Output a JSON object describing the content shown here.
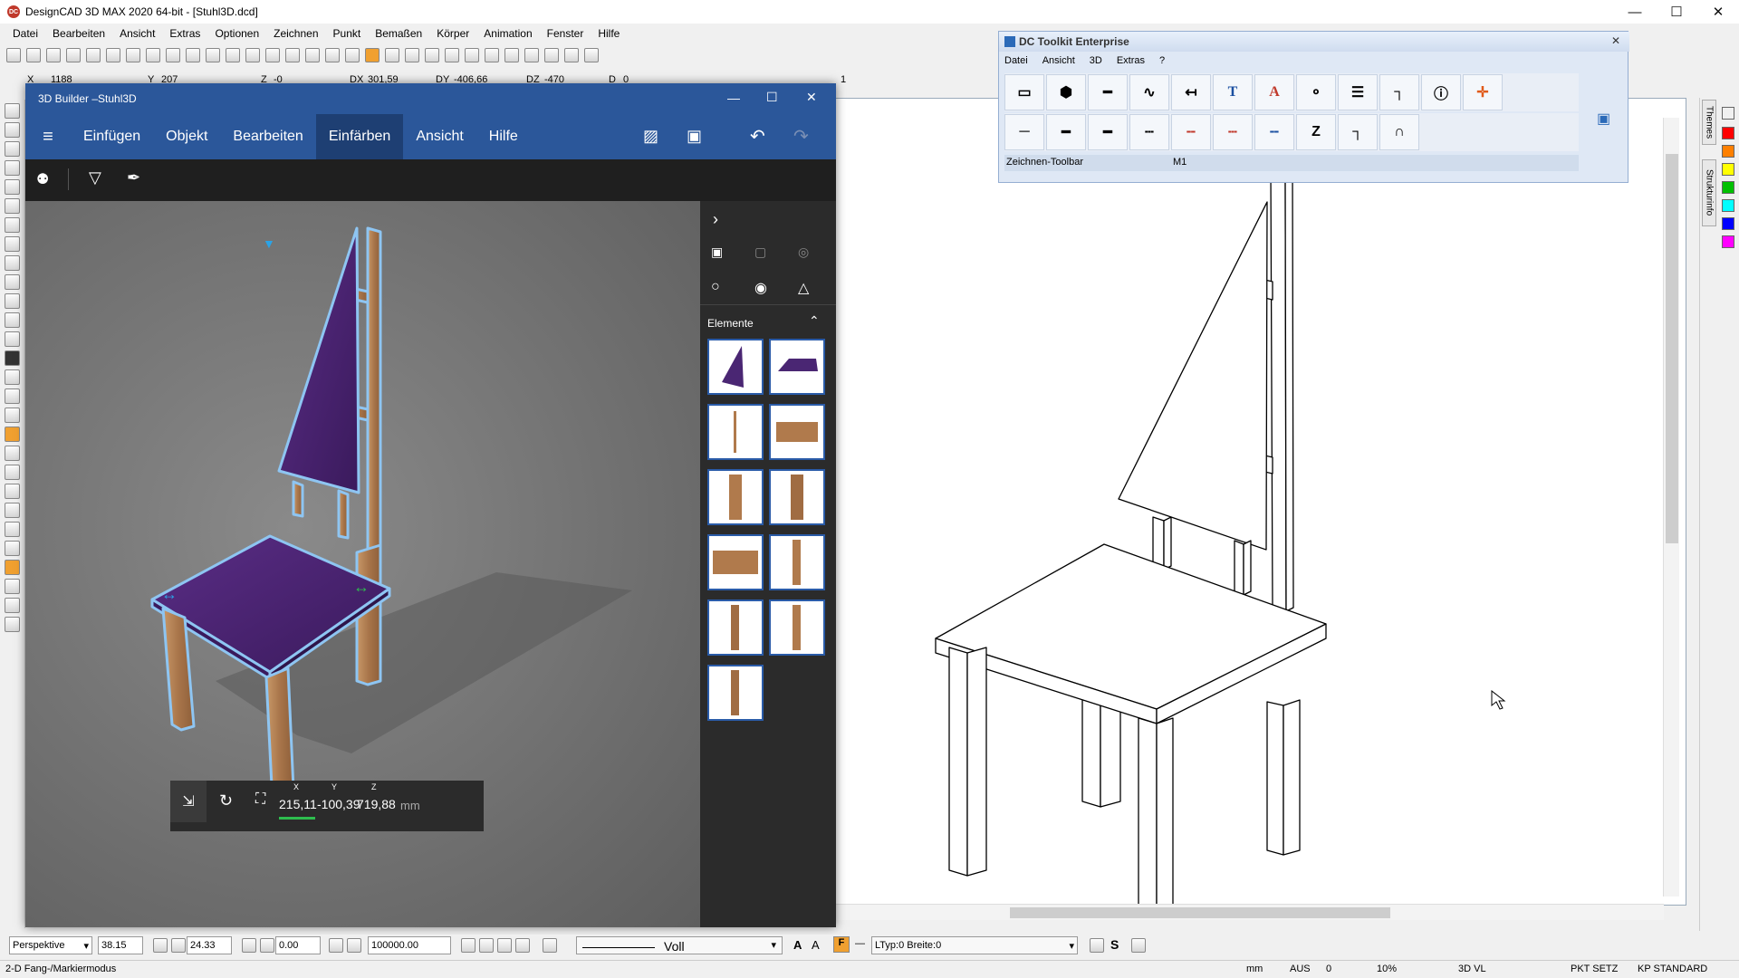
{
  "app": {
    "title": "DesignCAD 3D MAX 2020 64-bit - [Stuhl3D.dcd]",
    "logo": "DC"
  },
  "menubar": [
    "Datei",
    "Bearbeiten",
    "Ansicht",
    "Extras",
    "Optionen",
    "Zeichnen",
    "Punkt",
    "Bemaßen",
    "Körper",
    "Animation",
    "Fenster",
    "Hilfe"
  ],
  "coords": {
    "x_label": "X",
    "x": "1188",
    "y_label": "Y",
    "y": "207",
    "z_label": "Z",
    "z": "-0",
    "dx_label": "DX",
    "dx": "301,59",
    "dy_label": "DY",
    "dy": "-406,66",
    "dz_label": "DZ",
    "dz": "-470",
    "d_label": "D",
    "d": "0",
    "field_value": "1"
  },
  "builder": {
    "title": "3D Builder –Stuhl3D",
    "menu": [
      "Einfügen",
      "Objekt",
      "Bearbeiten",
      "Einfärben",
      "Ansicht",
      "Hilfe"
    ],
    "active_menu": "Einfärben",
    "panel_title": "Elemente",
    "coords": {
      "x_label": "X",
      "y_label": "Y",
      "z_label": "Z",
      "x": "215,11",
      "y": "-100,39",
      "z": "719,88",
      "unit": "mm"
    }
  },
  "toolkit": {
    "title": "DC Toolkit Enterprise",
    "menu": [
      "Datei",
      "Ansicht",
      "3D",
      "Extras",
      "?"
    ],
    "status_left": "Zeichnen-Toolbar",
    "status_mid": "M1"
  },
  "right_tabs": [
    "Themes",
    "Strukturinfo"
  ],
  "palette": [
    "#000000",
    "#ff0000",
    "#ff8000",
    "#ffff00",
    "#00c000",
    "#00ffff",
    "#0000ff",
    "#ff00ff"
  ],
  "bottombar": {
    "view": "Perspektive",
    "v1": "38.15",
    "v2": "24.33",
    "v3": "0.00",
    "v4": "100000.00",
    "linestyle": "Voll",
    "ltyp": "LTyp:0",
    "breite": "Breite:0"
  },
  "statusbar": {
    "mode": "2-D Fang-/Markiermodus",
    "unit": "mm",
    "aus": "AUS",
    "zero": "0",
    "pct": "10%",
    "vl": "3D VL",
    "pkt": "PKT SETZ",
    "kp": "KP STANDARD"
  }
}
